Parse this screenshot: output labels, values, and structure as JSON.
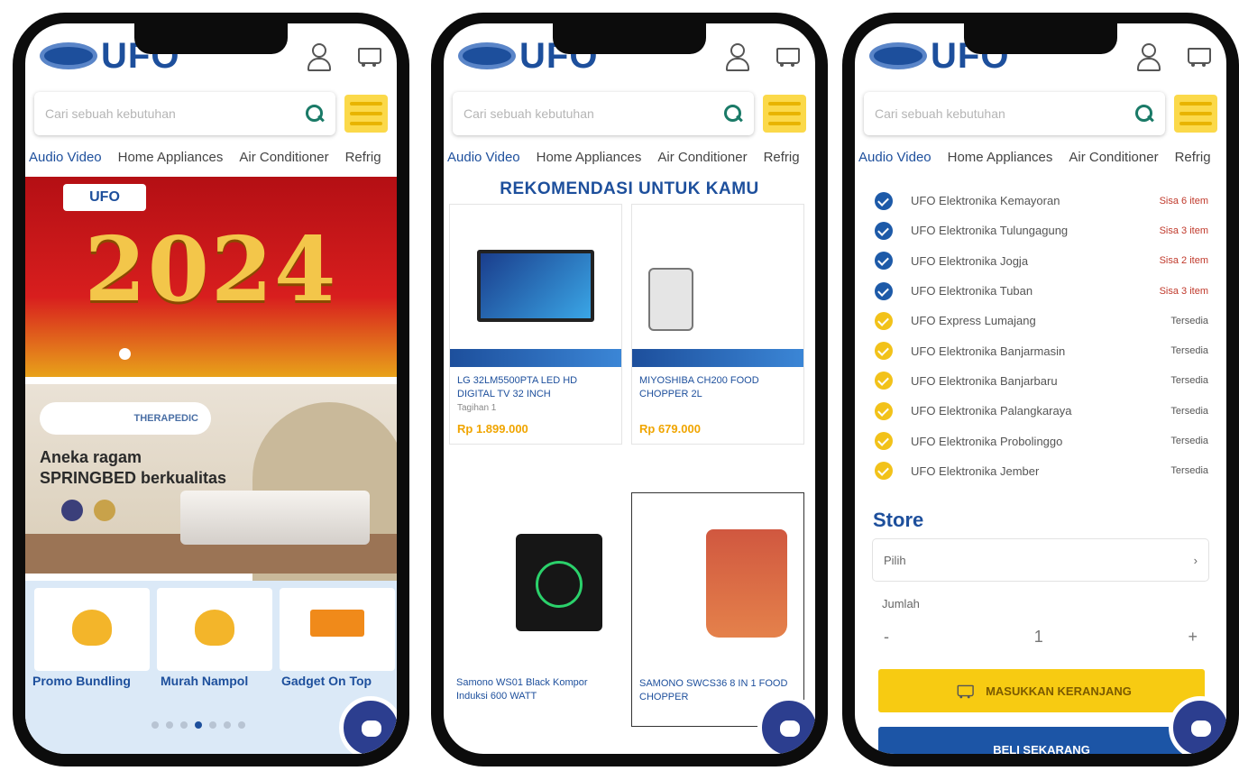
{
  "common": {
    "logo_text": "UFO",
    "search_placeholder": "Cari sebuah kebutuhan",
    "categories": [
      "Audio Video",
      "Home Appliances",
      "Air Conditioner",
      "Refrig"
    ]
  },
  "phone1": {
    "banner1_logo": "UFO",
    "banner1_year": "2024",
    "banner2_brand": "THERAPEDIC",
    "banner2_text_line1": "Aneka ragam",
    "banner2_text_line2": "SPRINGBED berkualitas",
    "promo_labels": [
      "Promo Bundling",
      "Murah Nampol",
      "Gadget On Top"
    ]
  },
  "phone2": {
    "section_title": "REKOMENDASI UNTUK KAMU",
    "products": [
      {
        "name": "LG 32LM5500PTA LED HD DIGITAL TV 32 INCH",
        "sub": "Tagihan 1",
        "price": "Rp 1.899.000"
      },
      {
        "name": "MIYOSHIBA CH200 FOOD CHOPPER 2L",
        "sub": "",
        "price": "Rp 679.000"
      },
      {
        "name": "Samono WS01 Black Kompor Induksi 600 WATT",
        "sub": "",
        "price": ""
      },
      {
        "name": "SAMONO SWCS36 8 IN 1 FOOD CHOPPER",
        "sub": "",
        "price": ""
      }
    ]
  },
  "phone3": {
    "stores": [
      {
        "name": "UFO Elektronika Kemayoran",
        "stock": "Sisa 6 item",
        "status": "available"
      },
      {
        "name": "UFO Elektronika Tulungagung",
        "stock": "Sisa 3 item",
        "status": "available"
      },
      {
        "name": "UFO Elektronika Jogja",
        "stock": "Sisa 2 item",
        "status": "available"
      },
      {
        "name": "UFO Elektronika Tuban",
        "stock": "Sisa 3 item",
        "status": "available"
      },
      {
        "name": "UFO Express Lumajang",
        "stock": "Tersedia",
        "status": "other"
      },
      {
        "name": "UFO Elektronika Banjarmasin",
        "stock": "Tersedia",
        "status": "other"
      },
      {
        "name": "UFO Elektronika Banjarbaru",
        "stock": "Tersedia",
        "status": "other"
      },
      {
        "name": "UFO Elektronika Palangkaraya",
        "stock": "Tersedia",
        "status": "other"
      },
      {
        "name": "UFO Elektronika Probolinggo",
        "stock": "Tersedia",
        "status": "other"
      },
      {
        "name": "UFO Elektronika Jember",
        "stock": "Tersedia",
        "status": "other"
      }
    ],
    "store_heading": "Store",
    "store_selected": "Pilih",
    "qty_label": "Jumlah",
    "qty_minus": "-",
    "qty_value": "1",
    "qty_plus": "+",
    "cart_button": "MASUKKAN KERANJANG",
    "buy_button": "BELI SEKARANG"
  },
  "colors": {
    "brand_blue": "#1d4f9c",
    "accent_yellow": "#f7cb12",
    "check_blue": "#1d5aa8",
    "check_yellow": "#f2c21a"
  }
}
